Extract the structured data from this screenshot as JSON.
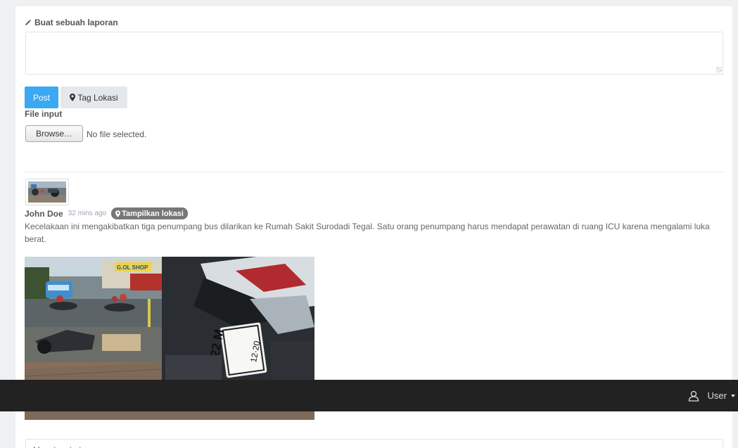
{
  "report_form": {
    "label": "Buat sebuah laporan",
    "textarea_value": "",
    "post_button": "Post",
    "tag_location_button": "Tag Lokasi",
    "file_label": "File input",
    "browse_button": "Browse…",
    "file_status": "No file selected."
  },
  "post": {
    "author": "John Doe",
    "time": "32 mins ago",
    "location_badge": "Tampilkan lokasi",
    "body": "Kecelakaan ini mengakibatkan tiga penumpang bus dilarikan ke Rumah Sakit Surodadi Tegal. Satu orang penumpang harus mendapat perawatan di ruang ICU karena mengalami luka berat.",
    "image_sign_text": "G.OL SHOP",
    "image_plate_text": "322 M",
    "image_plate_date": "12·20"
  },
  "reply": {
    "placeholder": "Masukan balasan..."
  },
  "navbar": {
    "user_label": "User"
  },
  "colors": {
    "primary": "#3aa8f3",
    "navbar": "#222222",
    "badge": "#777777"
  }
}
